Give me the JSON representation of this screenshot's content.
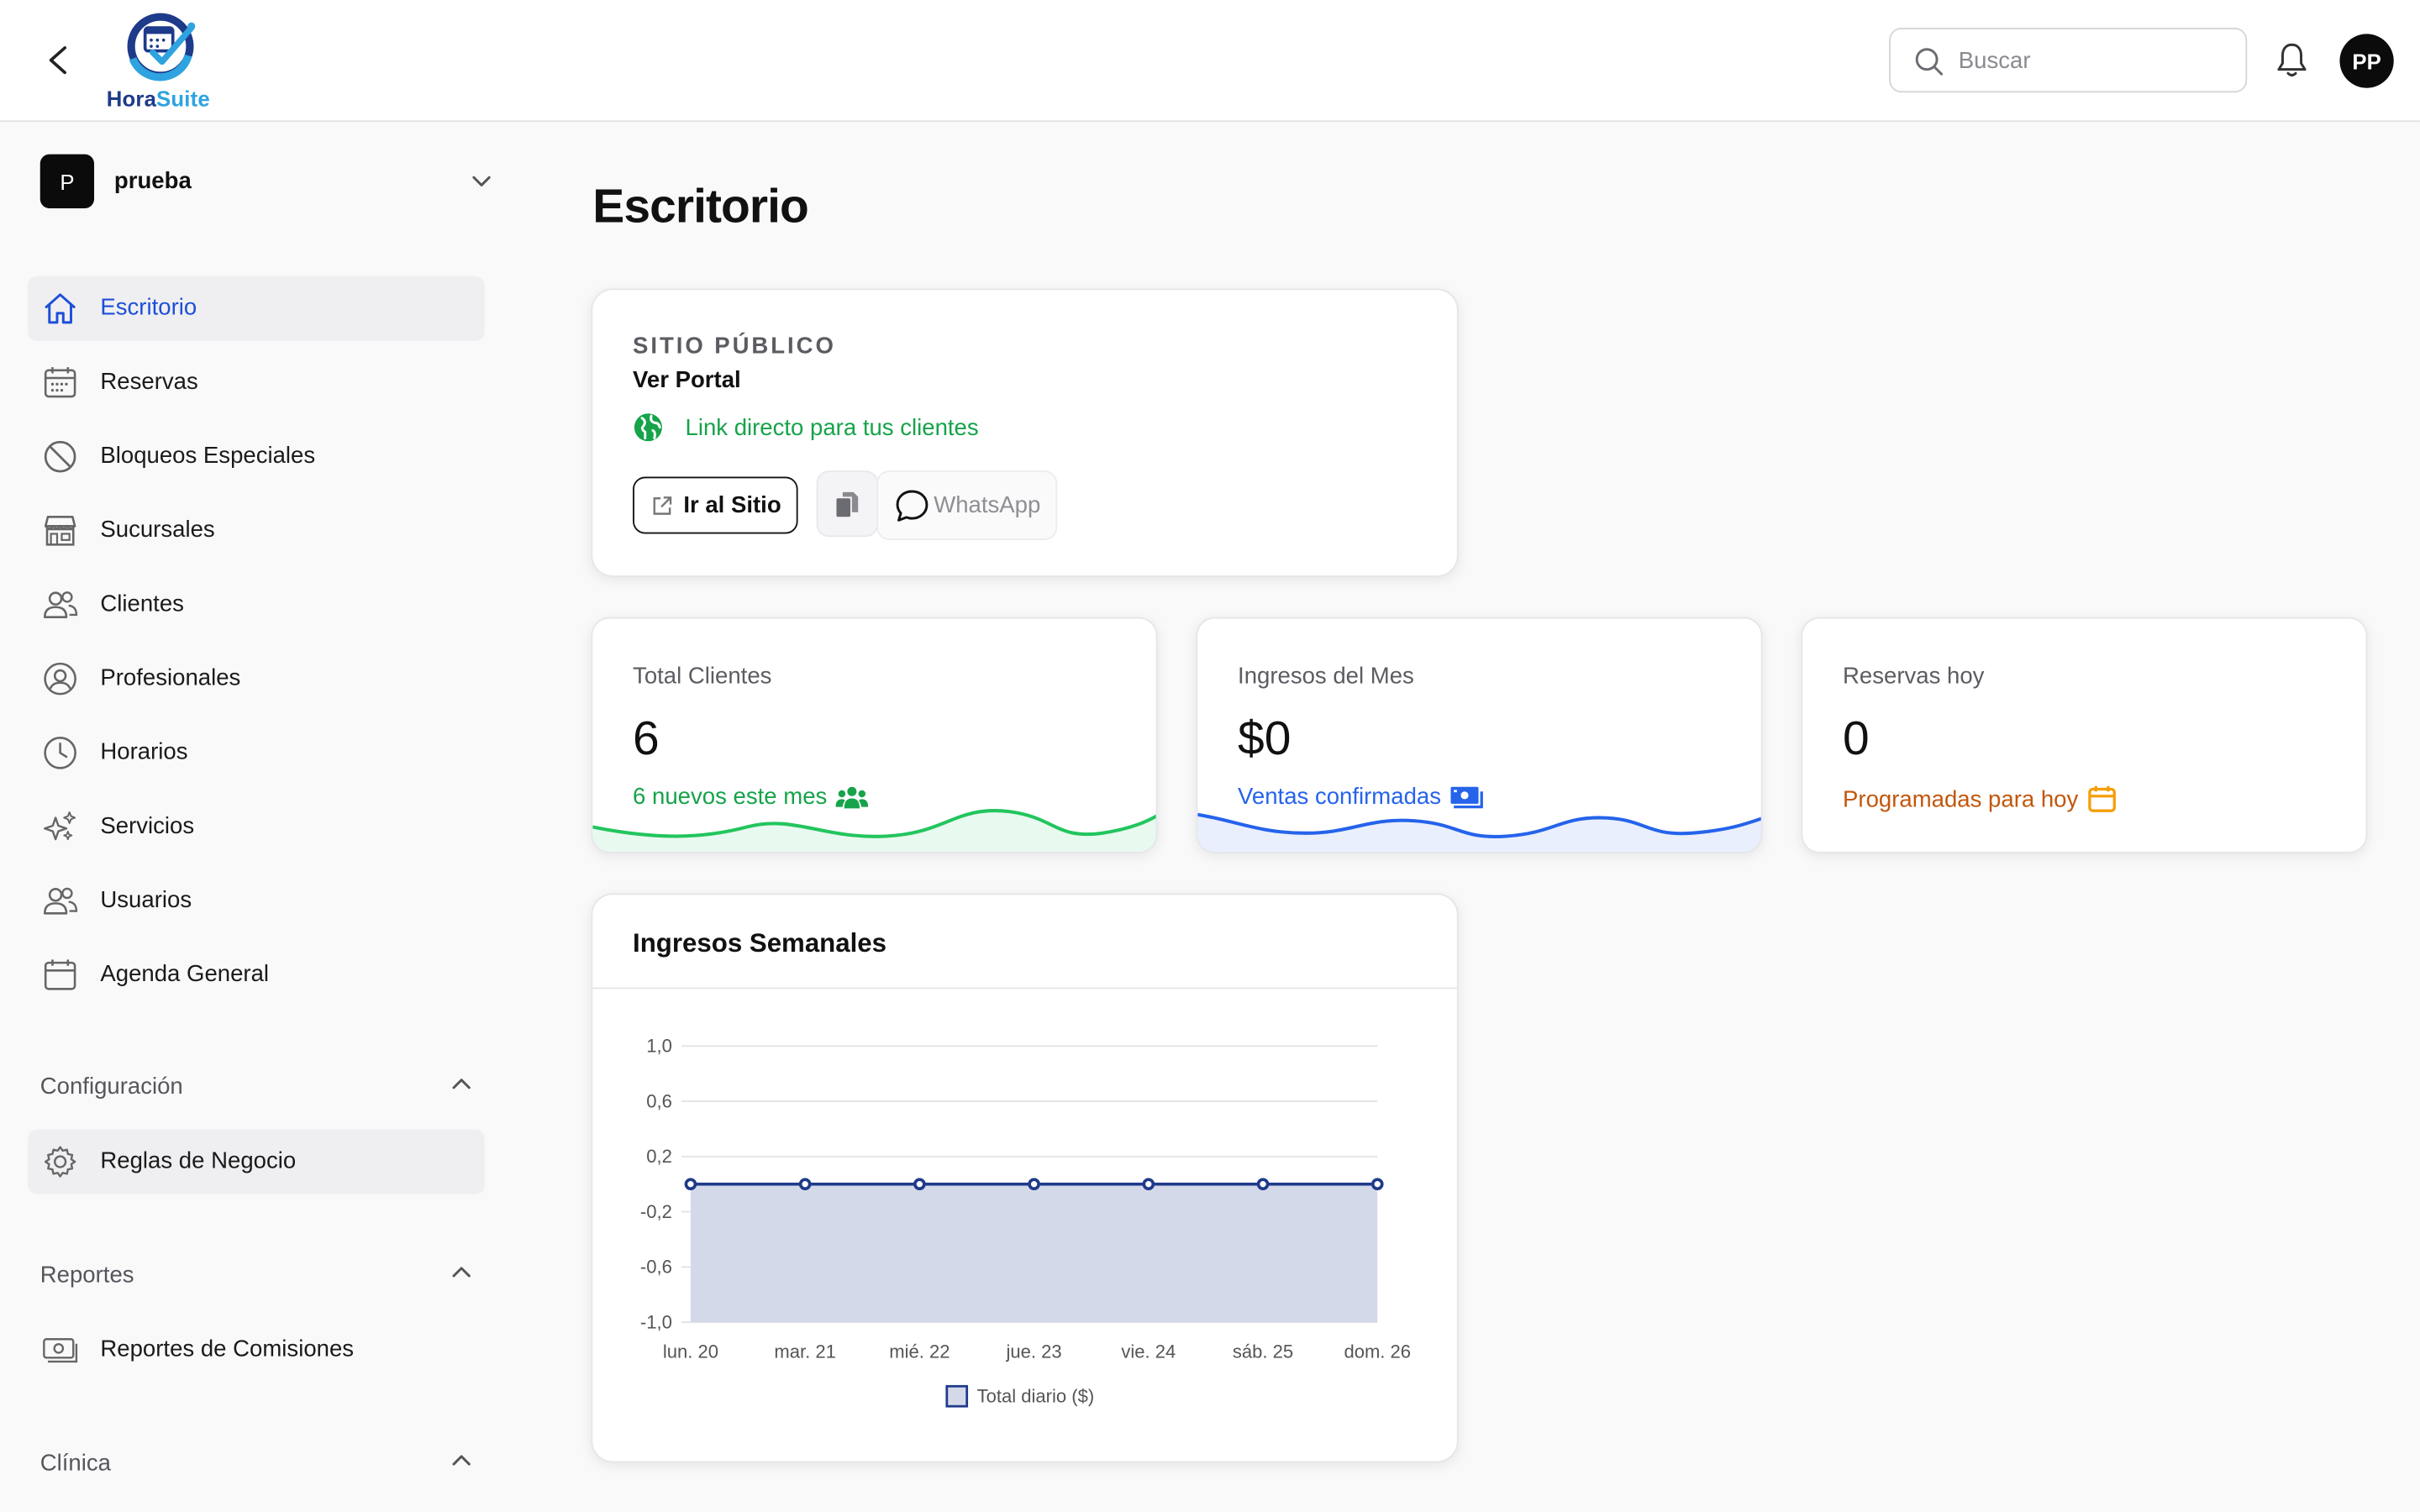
{
  "app": {
    "brand_part1": "Hora",
    "brand_part2": "Suite",
    "search_placeholder": "Buscar",
    "avatar_initials": "PP"
  },
  "sidebar": {
    "org_initial": "P",
    "org_name": "prueba",
    "items": [
      {
        "label": "Escritorio",
        "icon": "home-icon",
        "active": true
      },
      {
        "label": "Reservas",
        "icon": "calendar-grid-icon"
      },
      {
        "label": "Bloqueos Especiales",
        "icon": "block-icon"
      },
      {
        "label": "Sucursales",
        "icon": "store-icon"
      },
      {
        "label": "Clientes",
        "icon": "users-icon"
      },
      {
        "label": "Profesionales",
        "icon": "user-circle-icon"
      },
      {
        "label": "Horarios",
        "icon": "clock-icon"
      },
      {
        "label": "Servicios",
        "icon": "sparkles-icon"
      },
      {
        "label": "Usuarios",
        "icon": "users-icon"
      },
      {
        "label": "Agenda General",
        "icon": "calendar-icon"
      }
    ],
    "sections": [
      {
        "label": "Configuración",
        "items": [
          {
            "label": "Reglas de Negocio",
            "icon": "gear-icon"
          }
        ]
      },
      {
        "label": "Reportes",
        "items": [
          {
            "label": "Reportes de Comisiones",
            "icon": "money-icon"
          }
        ]
      },
      {
        "label": "Clínica",
        "items": []
      }
    ]
  },
  "main": {
    "page_title": "Escritorio",
    "public_site": {
      "eyebrow": "SITIO PÚBLICO",
      "title": "Ver Portal",
      "link_text": "Link directo para tus clientes",
      "go_button": "Ir al Sitio",
      "whatsapp_button": "WhatsApp"
    },
    "stats": [
      {
        "label": "Total Clientes",
        "value": "6",
        "sub": "6 nuevos este mes",
        "color": "#16a34a",
        "icon": "users-group-icon"
      },
      {
        "label": "Ingresos del Mes",
        "value": "$0",
        "sub": "Ventas confirmadas",
        "color": "#2563eb",
        "icon": "money-bill-icon"
      },
      {
        "label": "Reservas hoy",
        "value": "0",
        "sub": "Programadas para hoy",
        "color": "#c2570c",
        "icon": "calendar-icon"
      }
    ],
    "weekly_chart_title": "Ingresos Semanales"
  },
  "colors": {
    "accent": "#1d4ed8",
    "chart_line": "#1e3a8a",
    "chart_fill": "#d4d9ea"
  },
  "chart_data": {
    "type": "area",
    "categories": [
      "lun. 20",
      "mar. 21",
      "mié. 22",
      "jue. 23",
      "vie. 24",
      "sáb. 25",
      "dom. 26"
    ],
    "series": [
      {
        "name": "Total diario ($)",
        "values": [
          0,
          0,
          0,
          0,
          0,
          0,
          0
        ]
      }
    ],
    "y_ticks": [
      "1,0",
      "0,6",
      "0,2",
      "-0,2",
      "-0,6",
      "-1,0"
    ],
    "ylim": [
      -1,
      1
    ],
    "grid": true,
    "legend": "bottom"
  }
}
